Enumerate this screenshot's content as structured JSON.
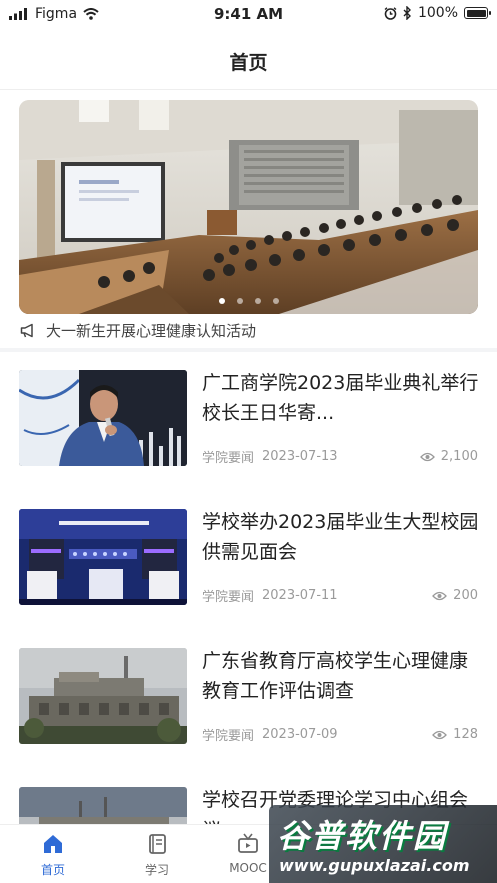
{
  "status_bar": {
    "carrier": "Figma",
    "time": "9:41 AM",
    "battery": "100%",
    "battery_level": 1.0
  },
  "header": {
    "title": "首页"
  },
  "banner": {
    "slide_count": 4,
    "active_index": 0,
    "notice_icon": "megaphone-icon",
    "notice_text": "大一新生开展心理健康认知活动"
  },
  "news": [
    {
      "title": "广工商学院2023届毕业典礼举行校长王日华寄...",
      "category": "学院要闻",
      "date": "2023-07-13",
      "views": "2,100"
    },
    {
      "title": "学校举办2023届毕业生大型校园供需见面会",
      "category": "学院要闻",
      "date": "2023-07-11",
      "views": "200"
    },
    {
      "title": "广东省教育厅高校学生心理健康教育工作评估调查",
      "category": "学院要闻",
      "date": "2023-07-09",
      "views": "128"
    },
    {
      "title": "学校召开党委理论学习中心组会议"
    }
  ],
  "tabbar": {
    "accent": "#2f6bd6",
    "tabs": [
      {
        "label": "首页",
        "icon": "home-icon",
        "active": true
      },
      {
        "label": "学习",
        "icon": "book-icon",
        "active": false
      },
      {
        "label": "MOOC",
        "icon": "tv-icon",
        "active": false
      }
    ]
  },
  "watermark": {
    "top": "谷普软件园",
    "bottom": "www.gupuxlazai.com"
  }
}
